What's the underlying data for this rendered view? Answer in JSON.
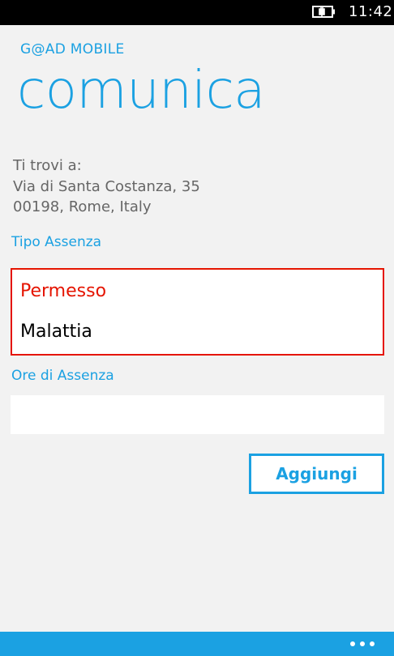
{
  "status_bar": {
    "time": "11:42",
    "battery_icon": "battery-charging-icon"
  },
  "app_name": "G@AD MOBILE",
  "page_title": "comunica",
  "location": {
    "label": "Ti trovi a:",
    "address_line1": "Via di Santa Costanza, 35",
    "address_line2": "00198, Rome, Italy"
  },
  "absence_type": {
    "label": "Tipo Assenza",
    "options": [
      "Permesso",
      "Malattia"
    ],
    "selected": "Permesso",
    "selected_color": "#e51400"
  },
  "absence_hours": {
    "label": "Ore di Assenza",
    "value": "",
    "placeholder": ""
  },
  "add_button_label": "Aggiungi",
  "app_bar": {
    "more_icon": "ellipsis-icon",
    "accent_color": "#1ba1e2"
  }
}
